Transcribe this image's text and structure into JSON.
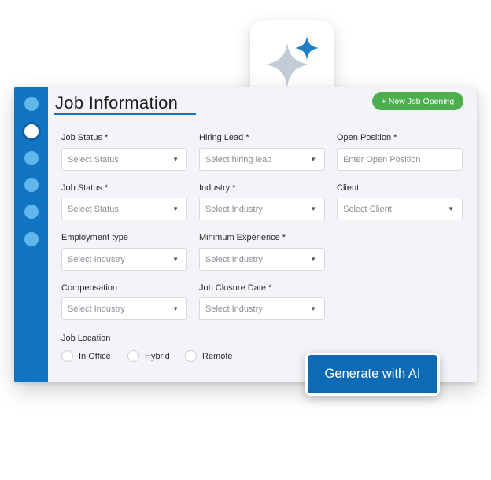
{
  "header": {
    "title": "Job Information",
    "new_button": "+ New Job Opening"
  },
  "sidebar": {
    "steps": [
      {
        "name": "step-1",
        "active": false
      },
      {
        "name": "step-2",
        "active": true
      },
      {
        "name": "step-3",
        "active": false
      },
      {
        "name": "step-4",
        "active": false
      },
      {
        "name": "step-5",
        "active": false
      },
      {
        "name": "step-6",
        "active": false
      }
    ]
  },
  "form": {
    "job_status_1": {
      "label": "Job Status *",
      "placeholder": "Select Status"
    },
    "hiring_lead": {
      "label": "Hiring Lead *",
      "placeholder": "Select hiring lead"
    },
    "open_position": {
      "label": "Open Position *",
      "placeholder": "Enter Open Position"
    },
    "job_status_2": {
      "label": "Job Status *",
      "placeholder": "Select Status"
    },
    "industry": {
      "label": "Industry *",
      "placeholder": "Select Industry"
    },
    "client": {
      "label": "Client",
      "placeholder": "Select Client"
    },
    "employment_type": {
      "label": "Employment type",
      "placeholder": "Select Industry"
    },
    "min_experience": {
      "label": "Minimum  Experience *",
      "placeholder": "Select Industry"
    },
    "compensation": {
      "label": "Compensation",
      "placeholder": "Select Industry"
    },
    "closure_date": {
      "label": "Job Closure Date *",
      "placeholder": "Select Industry"
    },
    "job_location": {
      "label": "Job Location",
      "options": [
        "In Office",
        "Hybrid",
        "Remote"
      ]
    }
  },
  "generate_button": "Generate with AI",
  "icons": {
    "dropdown": "▼",
    "sparkle": "sparkle-icon"
  },
  "colors": {
    "brand_blue": "#1175c4",
    "green": "#4cae4f",
    "step_dot": "#5fb7ec",
    "sparkle_grey": "#c3ccd6",
    "sparkle_blue": "#1f80c8"
  }
}
